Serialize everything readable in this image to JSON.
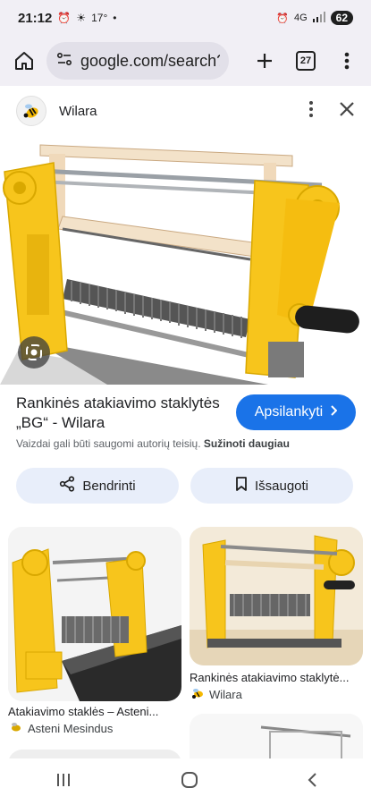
{
  "status": {
    "time": "21:12",
    "temperature": "17°",
    "network": "4G",
    "battery": "62"
  },
  "browser": {
    "url": "google.com/search?",
    "tab_count": "27"
  },
  "viewer": {
    "site_name": "Wilara",
    "title": "Rankinės atakiavimo staklytės „BG“ - Wilara",
    "visit_label": "Apsilankyti",
    "copyright_text": "Vaizdai gali būti saugomi autorių teisių.",
    "learn_more": "Sužinoti daugiau",
    "share_label": "Bendrinti",
    "save_label": "Išsaugoti"
  },
  "related": [
    {
      "caption": "Atakiavimo staklės – Asteni...",
      "source": "Asteni Mesindus"
    },
    {
      "caption": "Rankinės atakiavimo staklytė...",
      "source": "Wilara"
    }
  ],
  "colors": {
    "accent": "#1a73e8",
    "machine_yellow": "#f7c51c",
    "chrome_bg": "#f1eff5"
  },
  "icons": [
    "home-icon",
    "site-info-icon",
    "new-tab-icon",
    "tab-switcher-icon",
    "more-vert-icon",
    "bee-logo-icon",
    "close-icon",
    "lens-icon",
    "share-icon",
    "bookmark-icon",
    "recents-icon",
    "home-nav-icon",
    "back-icon"
  ]
}
